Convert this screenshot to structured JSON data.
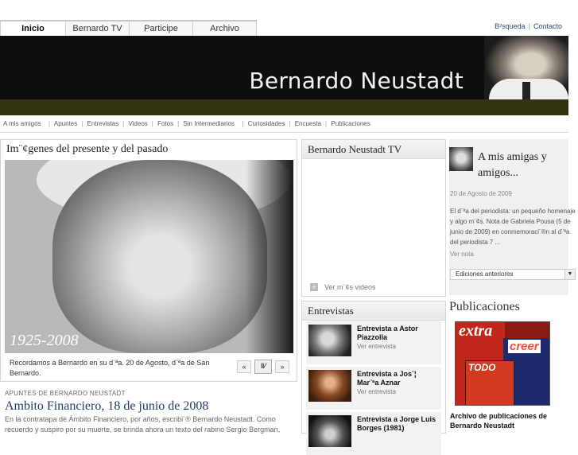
{
  "nav": {
    "tabs": [
      "Inicio",
      "Bernardo TV",
      "Participe",
      "Archivo"
    ],
    "search_label": "B²squeda",
    "contact_label": "Contacto"
  },
  "banner": {
    "title": "Bernardo Neustadt"
  },
  "sections": [
    "A mis amigos",
    "Apuntes",
    "Entrevistas",
    "Videos",
    "Fotos",
    "Sin Intermediarios",
    "Curiosidades",
    "Encuesta",
    "Publicaciones"
  ],
  "feature": {
    "heading": "Im¨¢genes del presente y del pasado",
    "years": "1925-2008",
    "caption": "Recordamos a Bernardo en su d¨ªa. 20 de Agosto, d¨ªa de San Bernardo.",
    "prev_label": "«",
    "play_label": "‖⁄",
    "next_label": "»"
  },
  "article": {
    "kicker": "APUNTES DE BERNARDO NEUSTADT",
    "title": "Ambito Financiero, 18 de junio de 2008",
    "body": "En la contratapa de Ámbito Financiero, por años, escribi¨® Bernardo Neustadt. Como recuerdo y suspiro por su muerte, se brinda ahora un texto del rabino Sergio Bergman,"
  },
  "tv": {
    "heading": "Bernardo Neustadt TV",
    "more_videos": "Ver m¨¢s videos"
  },
  "interviews": {
    "heading": "Entrevistas",
    "items": [
      {
        "name": "Entrevista a Astor Piazzolla",
        "link": "Ver entrevista"
      },
      {
        "name": "Entrevista a Jos¨¦ Mar¨ªa Aznar",
        "link": "Ver entrevista"
      },
      {
        "name": "Entrevista a Jorge Luis Borges (1981)",
        "link": ""
      }
    ]
  },
  "amigos": {
    "title": "A mis amigas y amigos...",
    "date": "20 de Agosto de 2009",
    "text": "El d¨ªa del periodista: un pequeño homenaje y algo m¨¢s. Nota de Gabriela Pousa (5 de junio de 2009) en conmemoraci¨®n al d¨ªa del periodista 7 ...",
    "more": "Ver nota",
    "select_value": "Ediciones anteriores"
  },
  "publicaciones": {
    "heading": "Publicaciones",
    "caption": "Archivo de publicaciones de Bernardo Neustadt",
    "mag_words": [
      "extra",
      "creer",
      "TODO"
    ]
  }
}
